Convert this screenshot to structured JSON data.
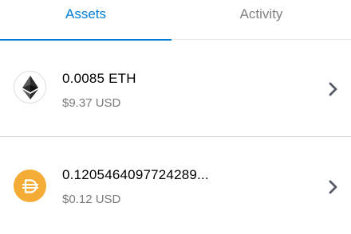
{
  "tabs": [
    {
      "label": "Assets",
      "active": true
    },
    {
      "label": "Activity",
      "active": false
    }
  ],
  "colors": {
    "accent": "#037dd6",
    "dai_brand": "#f5ac37",
    "muted_text": "#7a7a7a"
  },
  "assets": [
    {
      "icon": "ethereum-icon",
      "balance": "0.0085 ETH",
      "fiat": "$9.37 USD"
    },
    {
      "icon": "dai-icon",
      "balance": "0.1205464097724289...",
      "fiat": "$0.12 USD"
    }
  ]
}
